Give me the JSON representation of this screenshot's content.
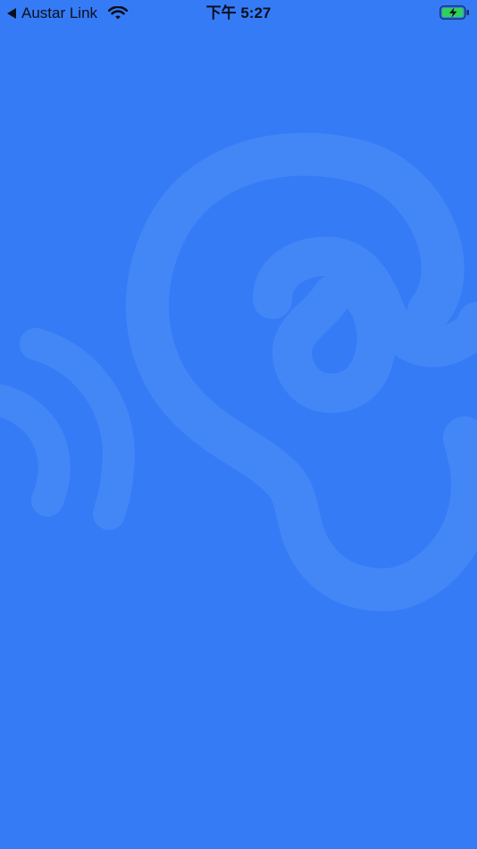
{
  "status_bar": {
    "back_app_label": "Austar Link",
    "time": "下午 5:27",
    "icons": {
      "back": "back-arrow-icon",
      "wifi": "wifi-icon",
      "battery": "battery-charging-icon"
    }
  },
  "splash": {
    "illustration": "ear-at-sign-sound-waves",
    "colors": {
      "background": "#367bf6",
      "illustration": "#4387f7",
      "battery_fill": "#30d158"
    }
  }
}
